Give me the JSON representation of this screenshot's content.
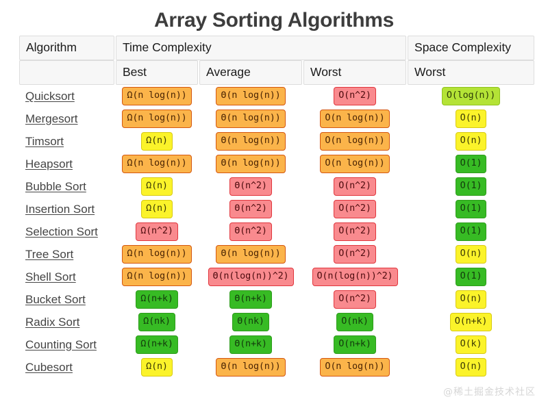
{
  "title": "Array Sorting Algorithms",
  "watermark": "@稀土掘金技术社区",
  "header": {
    "group_row": [
      {
        "label": "Algorithm",
        "colspan": 1
      },
      {
        "label": "Time Complexity",
        "colspan": 3
      },
      {
        "label": "Space Complexity",
        "colspan": 1
      }
    ],
    "sub_row": [
      {
        "label": ""
      },
      {
        "label": "Best"
      },
      {
        "label": "Average"
      },
      {
        "label": "Worst"
      },
      {
        "label": "Worst"
      }
    ]
  },
  "rows": [
    {
      "algorithm": "Quicksort",
      "best": {
        "text": "Ω(n log(n))",
        "color": "orange"
      },
      "average": {
        "text": "Θ(n log(n))",
        "color": "orange"
      },
      "worst": {
        "text": "O(n^2)",
        "color": "red"
      },
      "space": {
        "text": "O(log(n))",
        "color": "lime"
      }
    },
    {
      "algorithm": "Mergesort",
      "best": {
        "text": "Ω(n log(n))",
        "color": "orange"
      },
      "average": {
        "text": "Θ(n log(n))",
        "color": "orange"
      },
      "worst": {
        "text": "O(n log(n))",
        "color": "orange"
      },
      "space": {
        "text": "O(n)",
        "color": "yellow"
      }
    },
    {
      "algorithm": "Timsort",
      "best": {
        "text": "Ω(n)",
        "color": "yellow"
      },
      "average": {
        "text": "Θ(n log(n))",
        "color": "orange"
      },
      "worst": {
        "text": "O(n log(n))",
        "color": "orange"
      },
      "space": {
        "text": "O(n)",
        "color": "yellow"
      }
    },
    {
      "algorithm": "Heapsort",
      "best": {
        "text": "Ω(n log(n))",
        "color": "orange"
      },
      "average": {
        "text": "Θ(n log(n))",
        "color": "orange"
      },
      "worst": {
        "text": "O(n log(n))",
        "color": "orange"
      },
      "space": {
        "text": "O(1)",
        "color": "green"
      }
    },
    {
      "algorithm": "Bubble Sort",
      "best": {
        "text": "Ω(n)",
        "color": "yellow"
      },
      "average": {
        "text": "Θ(n^2)",
        "color": "red"
      },
      "worst": {
        "text": "O(n^2)",
        "color": "red"
      },
      "space": {
        "text": "O(1)",
        "color": "green"
      }
    },
    {
      "algorithm": "Insertion Sort",
      "best": {
        "text": "Ω(n)",
        "color": "yellow"
      },
      "average": {
        "text": "Θ(n^2)",
        "color": "red"
      },
      "worst": {
        "text": "O(n^2)",
        "color": "red"
      },
      "space": {
        "text": "O(1)",
        "color": "green"
      }
    },
    {
      "algorithm": "Selection Sort",
      "best": {
        "text": "Ω(n^2)",
        "color": "red"
      },
      "average": {
        "text": "Θ(n^2)",
        "color": "red"
      },
      "worst": {
        "text": "O(n^2)",
        "color": "red"
      },
      "space": {
        "text": "O(1)",
        "color": "green"
      }
    },
    {
      "algorithm": "Tree Sort",
      "best": {
        "text": "Ω(n log(n))",
        "color": "orange"
      },
      "average": {
        "text": "Θ(n log(n))",
        "color": "orange"
      },
      "worst": {
        "text": "O(n^2)",
        "color": "red"
      },
      "space": {
        "text": "O(n)",
        "color": "yellow"
      }
    },
    {
      "algorithm": "Shell Sort",
      "best": {
        "text": "Ω(n log(n))",
        "color": "orange"
      },
      "average": {
        "text": "Θ(n(log(n))^2)",
        "color": "red"
      },
      "worst": {
        "text": "O(n(log(n))^2)",
        "color": "red"
      },
      "space": {
        "text": "O(1)",
        "color": "green"
      }
    },
    {
      "algorithm": "Bucket Sort",
      "best": {
        "text": "Ω(n+k)",
        "color": "green"
      },
      "average": {
        "text": "Θ(n+k)",
        "color": "green"
      },
      "worst": {
        "text": "O(n^2)",
        "color": "red"
      },
      "space": {
        "text": "O(n)",
        "color": "yellow"
      }
    },
    {
      "algorithm": "Radix Sort",
      "best": {
        "text": "Ω(nk)",
        "color": "green"
      },
      "average": {
        "text": "Θ(nk)",
        "color": "green"
      },
      "worst": {
        "text": "O(nk)",
        "color": "green"
      },
      "space": {
        "text": "O(n+k)",
        "color": "yellow"
      }
    },
    {
      "algorithm": "Counting Sort",
      "best": {
        "text": "Ω(n+k)",
        "color": "green"
      },
      "average": {
        "text": "Θ(n+k)",
        "color": "green"
      },
      "worst": {
        "text": "O(n+k)",
        "color": "green"
      },
      "space": {
        "text": "O(k)",
        "color": "yellow"
      }
    },
    {
      "algorithm": "Cubesort",
      "best": {
        "text": "Ω(n)",
        "color": "yellow"
      },
      "average": {
        "text": "Θ(n log(n))",
        "color": "orange"
      },
      "worst": {
        "text": "O(n log(n))",
        "color": "orange"
      },
      "space": {
        "text": "O(n)",
        "color": "yellow"
      }
    }
  ],
  "colors": {
    "green": "#37bb24",
    "lime": "#b4e336",
    "yellow": "#fbf32a",
    "orange": "#fbb44a",
    "red": "#f98a8e",
    "title": "#3d3d3d"
  }
}
